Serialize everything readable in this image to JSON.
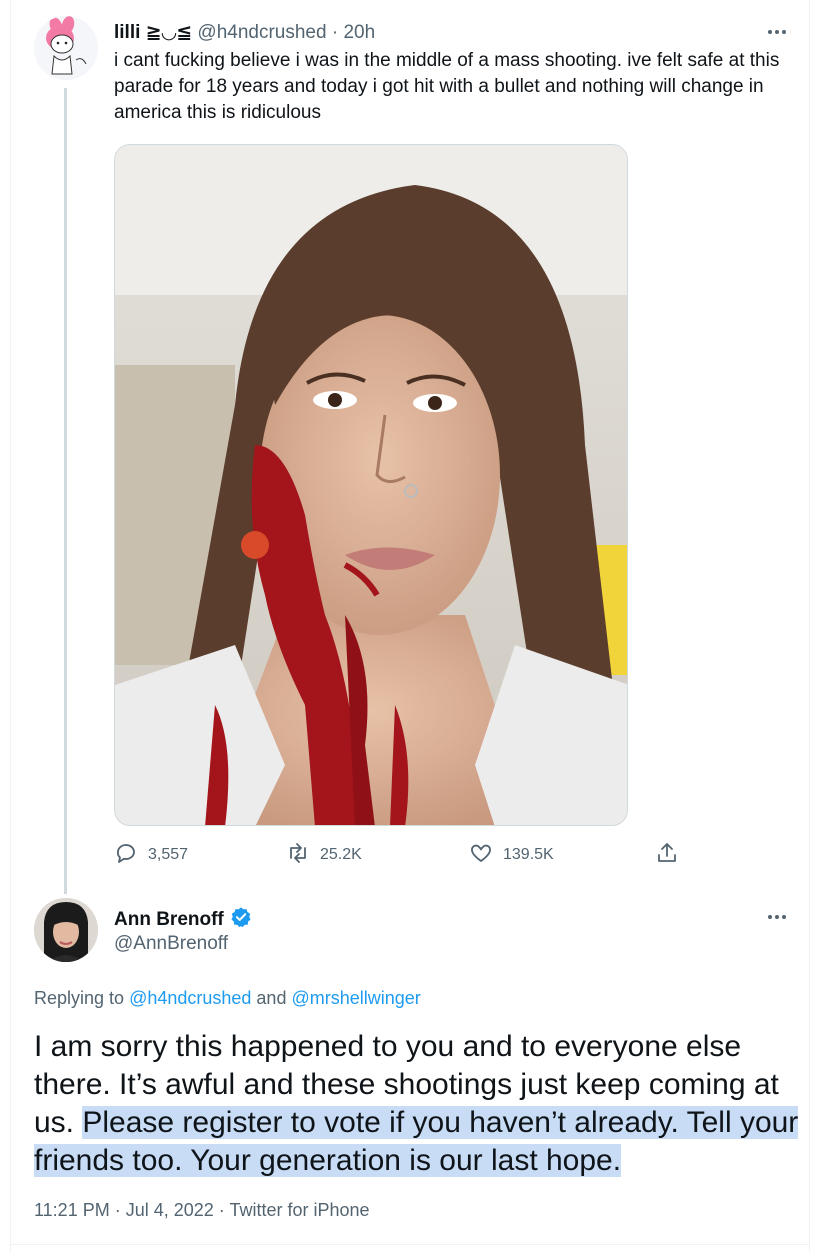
{
  "tweet1": {
    "author_name": "lilli ≧◡≦",
    "handle": "@h4ndcrushed",
    "separator": "·",
    "time": "20h",
    "text": "i cant fucking believe i was in the middle of a mass shooting. ive felt safe at this parade for 18 years and today i got hit with a bullet and nothing will change in america this is ridiculous",
    "stats": {
      "replies": "3,557",
      "retweets": "25.2K",
      "likes": "139.5K"
    },
    "icons": [
      "reply-icon",
      "retweet-icon",
      "like-icon",
      "share-icon",
      "more-icon"
    ]
  },
  "tweet2": {
    "author_name": "Ann Brenoff",
    "handle": "@AnnBrenoff",
    "verified": true,
    "replying_prefix": "Replying to ",
    "replying_user1": "@h4ndcrushed",
    "replying_and": " and ",
    "replying_user2": "@mrshellwinger",
    "text_plain": "I am sorry this happened to you and to everyone else there. It’s awful and these shootings just keep coming at us. ",
    "text_highlighted": "Please register to vote if you haven’t already. Tell your friends too. Your generation is our last hope.",
    "meta": "11:21 PM · Jul 4, 2022 · Twitter for iPhone"
  },
  "colors": {
    "text_primary": "#0f1419",
    "text_secondary": "#536471",
    "link": "#1d9bf0",
    "verified": "#1d9bf0",
    "highlight": "#c8dcf5",
    "thread_line": "#cfd9de"
  }
}
